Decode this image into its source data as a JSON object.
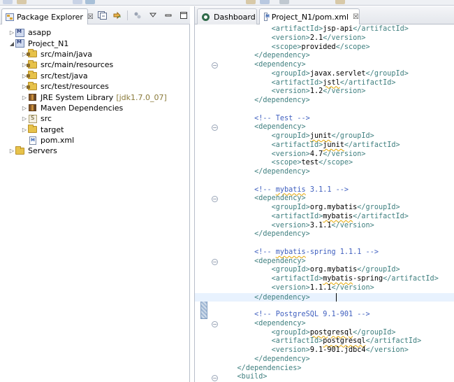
{
  "package_explorer": {
    "tab_label": "Package Explorer",
    "close_glyph": "☒",
    "tree": [
      {
        "label": "asapp",
        "extra": "",
        "indent": 0,
        "twisty": "▷",
        "icon": "project-icon"
      },
      {
        "label": "Project_N1",
        "extra": "",
        "indent": 0,
        "twisty": "◢",
        "icon": "project-icon"
      },
      {
        "label": "src/main/java",
        "extra": "",
        "indent": 1,
        "twisty": "▷",
        "icon": "source-folder-icon"
      },
      {
        "label": "src/main/resources",
        "extra": "",
        "indent": 1,
        "twisty": "▷",
        "icon": "source-folder-icon"
      },
      {
        "label": "src/test/java",
        "extra": "",
        "indent": 1,
        "twisty": "▷",
        "icon": "source-folder-icon"
      },
      {
        "label": "src/test/resources",
        "extra": "",
        "indent": 1,
        "twisty": "▷",
        "icon": "source-folder-icon"
      },
      {
        "label": "JRE System Library",
        "extra": "[jdk1.7.0_07]",
        "indent": 1,
        "twisty": "▷",
        "icon": "library-icon"
      },
      {
        "label": "Maven Dependencies",
        "extra": "",
        "indent": 1,
        "twisty": "▷",
        "icon": "library-icon"
      },
      {
        "label": "src",
        "extra": "",
        "indent": 1,
        "twisty": "▷",
        "icon": "folder-icon"
      },
      {
        "label": "target",
        "extra": "",
        "indent": 1,
        "twisty": "▷",
        "icon": "folder-icon"
      },
      {
        "label": "pom.xml",
        "extra": "",
        "indent": 1,
        "twisty": "",
        "icon": "xml-file-icon"
      },
      {
        "label": "Servers",
        "extra": "",
        "indent": 0,
        "twisty": "▷",
        "icon": "folder-icon"
      }
    ]
  },
  "editor": {
    "tabs": [
      {
        "label": "Dashboard",
        "active": false
      },
      {
        "label": "Project_N1/pom.xml",
        "active": true
      }
    ],
    "close_glyph": "☒",
    "lines": [
      {
        "indent": 12,
        "segments": [
          {
            "t": "tag",
            "v": "<artifactId>"
          },
          {
            "t": "txt",
            "v": "jsp-api"
          },
          {
            "t": "tag",
            "v": "</artifactId>"
          }
        ]
      },
      {
        "indent": 12,
        "segments": [
          {
            "t": "tag",
            "v": "<version>"
          },
          {
            "t": "txt",
            "v": "2.1"
          },
          {
            "t": "tag",
            "v": "</version>"
          }
        ]
      },
      {
        "indent": 12,
        "segments": [
          {
            "t": "tag",
            "v": "<scope>"
          },
          {
            "t": "txt",
            "v": "provided"
          },
          {
            "t": "tag",
            "v": "</scope>"
          }
        ]
      },
      {
        "indent": 8,
        "segments": [
          {
            "t": "tag",
            "v": "</dependency>"
          }
        ]
      },
      {
        "indent": 8,
        "fold": true,
        "segments": [
          {
            "t": "tag",
            "v": "<dependency>"
          }
        ]
      },
      {
        "indent": 12,
        "segments": [
          {
            "t": "tag",
            "v": "<groupId>"
          },
          {
            "t": "txt",
            "v": "javax.servlet"
          },
          {
            "t": "tag",
            "v": "</groupId>"
          }
        ]
      },
      {
        "indent": 12,
        "segments": [
          {
            "t": "tag",
            "v": "<artifactId>"
          },
          {
            "t": "txt",
            "v": "jstl",
            "sq": true
          },
          {
            "t": "tag",
            "v": "</artifactId>"
          }
        ]
      },
      {
        "indent": 12,
        "segments": [
          {
            "t": "tag",
            "v": "<version>"
          },
          {
            "t": "txt",
            "v": "1.2"
          },
          {
            "t": "tag",
            "v": "</version>"
          }
        ]
      },
      {
        "indent": 8,
        "segments": [
          {
            "t": "tag",
            "v": "</dependency>"
          }
        ]
      },
      {
        "indent": 0,
        "segments": []
      },
      {
        "indent": 8,
        "segments": [
          {
            "t": "cmt",
            "v": "<!-- Test -->"
          }
        ]
      },
      {
        "indent": 8,
        "fold": true,
        "segments": [
          {
            "t": "tag",
            "v": "<dependency>"
          }
        ]
      },
      {
        "indent": 12,
        "segments": [
          {
            "t": "tag",
            "v": "<groupId>"
          },
          {
            "t": "txt",
            "v": "junit",
            "sq": true
          },
          {
            "t": "tag",
            "v": "</groupId>"
          }
        ]
      },
      {
        "indent": 12,
        "segments": [
          {
            "t": "tag",
            "v": "<artifactId>"
          },
          {
            "t": "txt",
            "v": "junit",
            "sq": true
          },
          {
            "t": "tag",
            "v": "</artifactId>"
          }
        ]
      },
      {
        "indent": 12,
        "segments": [
          {
            "t": "tag",
            "v": "<version>"
          },
          {
            "t": "txt",
            "v": "4.7"
          },
          {
            "t": "tag",
            "v": "</version>"
          }
        ]
      },
      {
        "indent": 12,
        "segments": [
          {
            "t": "tag",
            "v": "<scope>"
          },
          {
            "t": "txt",
            "v": "test"
          },
          {
            "t": "tag",
            "v": "</scope>"
          }
        ]
      },
      {
        "indent": 8,
        "segments": [
          {
            "t": "tag",
            "v": "</dependency>"
          }
        ]
      },
      {
        "indent": 0,
        "segments": []
      },
      {
        "indent": 8,
        "segments": [
          {
            "t": "cmt",
            "v": "<!-- "
          },
          {
            "t": "cmt",
            "v": "mybatis",
            "sq": true
          },
          {
            "t": "cmt",
            "v": " 3.1.1 -->"
          }
        ]
      },
      {
        "indent": 8,
        "fold": true,
        "segments": [
          {
            "t": "tag",
            "v": "<dependency>"
          }
        ]
      },
      {
        "indent": 12,
        "segments": [
          {
            "t": "tag",
            "v": "<groupId>"
          },
          {
            "t": "txt",
            "v": "org.mybatis"
          },
          {
            "t": "tag",
            "v": "</groupId>"
          }
        ]
      },
      {
        "indent": 12,
        "segments": [
          {
            "t": "tag",
            "v": "<artifactId>"
          },
          {
            "t": "txt",
            "v": "mybatis",
            "sq": true
          },
          {
            "t": "tag",
            "v": "</artifactId>"
          }
        ]
      },
      {
        "indent": 12,
        "segments": [
          {
            "t": "tag",
            "v": "<version>"
          },
          {
            "t": "txt",
            "v": "3.1.1"
          },
          {
            "t": "tag",
            "v": "</version>"
          }
        ]
      },
      {
        "indent": 8,
        "segments": [
          {
            "t": "tag",
            "v": "</dependency>"
          }
        ]
      },
      {
        "indent": 0,
        "segments": []
      },
      {
        "indent": 8,
        "segments": [
          {
            "t": "cmt",
            "v": "<!-- "
          },
          {
            "t": "cmt",
            "v": "mybatis",
            "sq": true
          },
          {
            "t": "cmt",
            "v": "-spring 1.1.1 -->"
          }
        ]
      },
      {
        "indent": 8,
        "fold": true,
        "segments": [
          {
            "t": "tag",
            "v": "<dependency>"
          }
        ]
      },
      {
        "indent": 12,
        "segments": [
          {
            "t": "tag",
            "v": "<groupId>"
          },
          {
            "t": "txt",
            "v": "org.mybatis"
          },
          {
            "t": "tag",
            "v": "</groupId>"
          }
        ]
      },
      {
        "indent": 12,
        "segments": [
          {
            "t": "tag",
            "v": "<artifactId>"
          },
          {
            "t": "txt",
            "v": "mybatis",
            "sq": true
          },
          {
            "t": "txt",
            "v": "-spring"
          },
          {
            "t": "tag",
            "v": "</artifactId>"
          }
        ]
      },
      {
        "indent": 12,
        "segments": [
          {
            "t": "tag",
            "v": "<version>"
          },
          {
            "t": "txt",
            "v": "1.1.1"
          },
          {
            "t": "tag",
            "v": "</version>"
          }
        ]
      },
      {
        "indent": 8,
        "current": true,
        "segments": [
          {
            "t": "tag",
            "v": "</dependency>"
          }
        ]
      },
      {
        "indent": 0,
        "segments": []
      },
      {
        "indent": 8,
        "segments": [
          {
            "t": "cmt",
            "v": "<!-- PostgreSQL 9.1-901 -->"
          }
        ]
      },
      {
        "indent": 8,
        "fold": true,
        "segments": [
          {
            "t": "tag",
            "v": "<dependency>"
          }
        ]
      },
      {
        "indent": 12,
        "segments": [
          {
            "t": "tag",
            "v": "<groupId>"
          },
          {
            "t": "txt",
            "v": "postgresql",
            "sq": true
          },
          {
            "t": "tag",
            "v": "</groupId>"
          }
        ]
      },
      {
        "indent": 12,
        "segments": [
          {
            "t": "tag",
            "v": "<artifactId>"
          },
          {
            "t": "txt",
            "v": "postgresql",
            "sq": true
          },
          {
            "t": "tag",
            "v": "</artifactId>"
          }
        ]
      },
      {
        "indent": 12,
        "segments": [
          {
            "t": "tag",
            "v": "<version>"
          },
          {
            "t": "txt",
            "v": "9.1-901.jdbc4"
          },
          {
            "t": "tag",
            "v": "</version>"
          }
        ]
      },
      {
        "indent": 8,
        "segments": [
          {
            "t": "tag",
            "v": "</dependency>"
          }
        ]
      },
      {
        "indent": 4,
        "segments": [
          {
            "t": "tag",
            "v": "</dependencies>"
          }
        ]
      },
      {
        "indent": 4,
        "fold": true,
        "segments": [
          {
            "t": "tag",
            "v": "<build>"
          }
        ]
      }
    ]
  },
  "colors": {
    "tag": "#3f7f7f",
    "comment": "#3f5fbf",
    "text": "#000000",
    "current_line": "#e8f2fe"
  }
}
